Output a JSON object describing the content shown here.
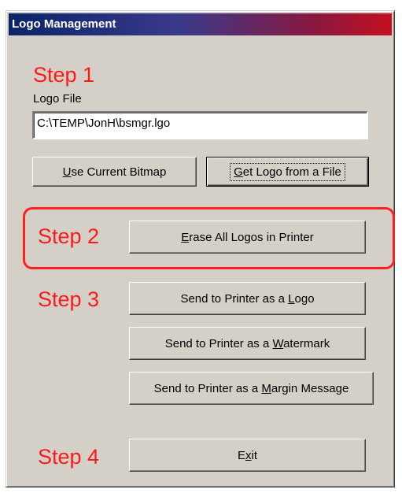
{
  "window": {
    "title": "Logo Management"
  },
  "step1": {
    "label": "Step 1",
    "field_label": "Logo File",
    "field_value": "C:\\TEMP\\JonH\\bsmgr.lgo",
    "buttons": {
      "use_current": {
        "accel": "U",
        "rest": "se Current Bitmap"
      },
      "get_logo": {
        "accel": "G",
        "rest": "et Logo from a File"
      }
    }
  },
  "step2": {
    "label": "Step 2",
    "erase": {
      "accel": "E",
      "rest": "rase All Logos in Printer"
    }
  },
  "step3": {
    "label": "Step 3",
    "send_logo": {
      "pre": "Send to Printer as a ",
      "accel": "L",
      "rest": "ogo"
    },
    "send_watermark": {
      "pre": "Send to Printer as a ",
      "accel": "W",
      "rest": "atermark"
    },
    "send_margin": {
      "pre": "Send to Printer as a ",
      "accel": "M",
      "rest": "argin Message"
    }
  },
  "step4": {
    "label": "Step 4",
    "exit": {
      "pre": "E",
      "accel": "x",
      "rest": "it"
    }
  },
  "colors": {
    "step_label": "#ff1a1a",
    "highlight_border": "#ff2020",
    "dialog_face": "#d4d0c8"
  }
}
